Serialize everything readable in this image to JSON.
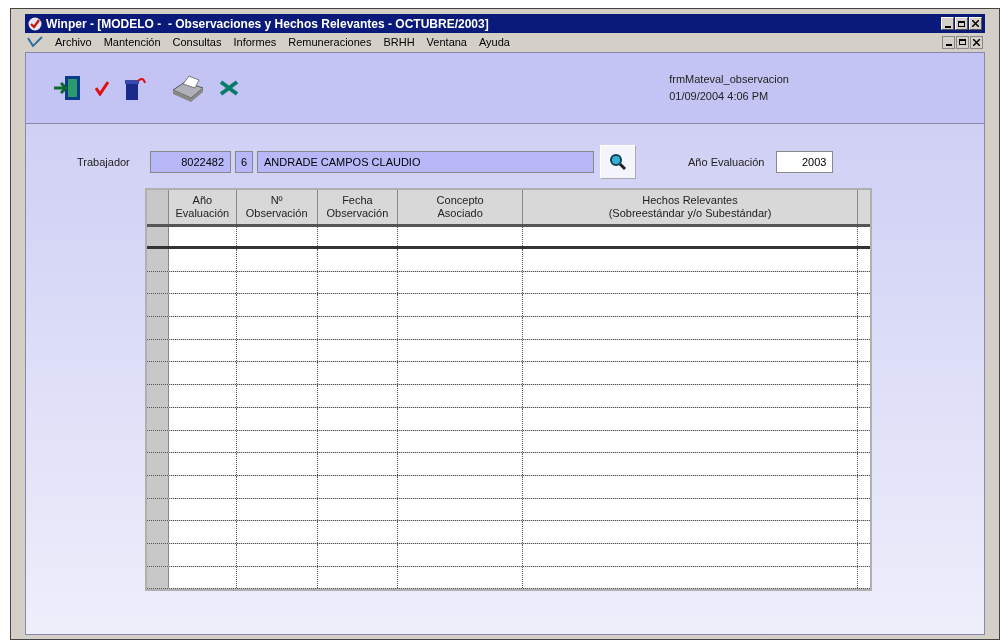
{
  "window": {
    "title": "Winper - [MODELO -  - Observaciones y Hechos Relevantes - OCTUBRE/2003]"
  },
  "menu": [
    "Archivo",
    "Mantención",
    "Consultas",
    "Informes",
    "Remuneraciones",
    "BRHH",
    "Ventana",
    "Ayuda"
  ],
  "form_info": {
    "form_name": "frmMateval_observacion",
    "timestamp": "01/09/2004 4:06 PM"
  },
  "trabajador": {
    "label": "Trabajador",
    "code": "8022482",
    "check_digit": "6",
    "name": "ANDRADE CAMPOS CLAUDIO"
  },
  "evaluation_year": {
    "label": "Año Evaluación",
    "value": "2003"
  },
  "table": {
    "columns": [
      {
        "line1": "Año",
        "line2": "Evaluación"
      },
      {
        "line1": "Nº",
        "line2": "Observación"
      },
      {
        "line1": "Fecha",
        "line2": "Observación"
      },
      {
        "line1": "Concepto",
        "line2": "Asociado"
      },
      {
        "line1": "Hechos Relevantes",
        "line2": "(Sobreestándar y/o Subestándar)"
      }
    ]
  }
}
